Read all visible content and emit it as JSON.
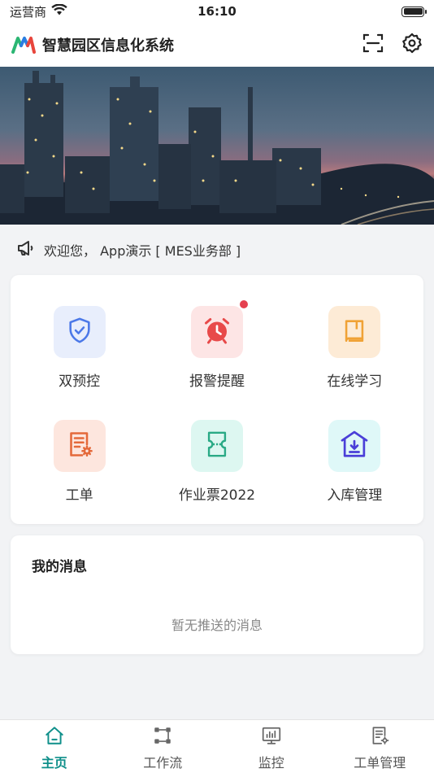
{
  "status": {
    "carrier": "运营商",
    "time": "16:10"
  },
  "header": {
    "title": "智慧园区信息化系统"
  },
  "welcome": {
    "text": "欢迎您， App演示 [ MES业务部 ]"
  },
  "grid": {
    "items": [
      {
        "label": "双预控",
        "icon": "shield-check-icon",
        "bg": "#e8eefc",
        "color": "#4b78e8"
      },
      {
        "label": "报警提醒",
        "icon": "alarm-clock-icon",
        "bg": "#fde5e5",
        "color": "#e84a4a",
        "badge": true
      },
      {
        "label": "在线学习",
        "icon": "book-icon",
        "bg": "#fdebd6",
        "color": "#f0a236"
      },
      {
        "label": "工单",
        "icon": "work-order-icon",
        "bg": "#fde6de",
        "color": "#e4693a"
      },
      {
        "label": "作业票2022",
        "icon": "ticket-icon",
        "bg": "#ddf7f1",
        "color": "#2aaa86"
      },
      {
        "label": "入库管理",
        "icon": "warehouse-in-icon",
        "bg": "#dff8f8",
        "color": "#4a3fd8"
      }
    ]
  },
  "messages": {
    "title": "我的消息",
    "empty": "暂无推送的消息"
  },
  "tabbar": {
    "tabs": [
      {
        "label": "主页",
        "icon": "home-icon",
        "active": true
      },
      {
        "label": "工作流",
        "icon": "workflow-icon"
      },
      {
        "label": "监控",
        "icon": "monitor-icon"
      },
      {
        "label": "工单管理",
        "icon": "work-order-manage-icon"
      }
    ]
  },
  "colors": {
    "accent": "#0e8f8a",
    "badge": "#e5404f"
  }
}
